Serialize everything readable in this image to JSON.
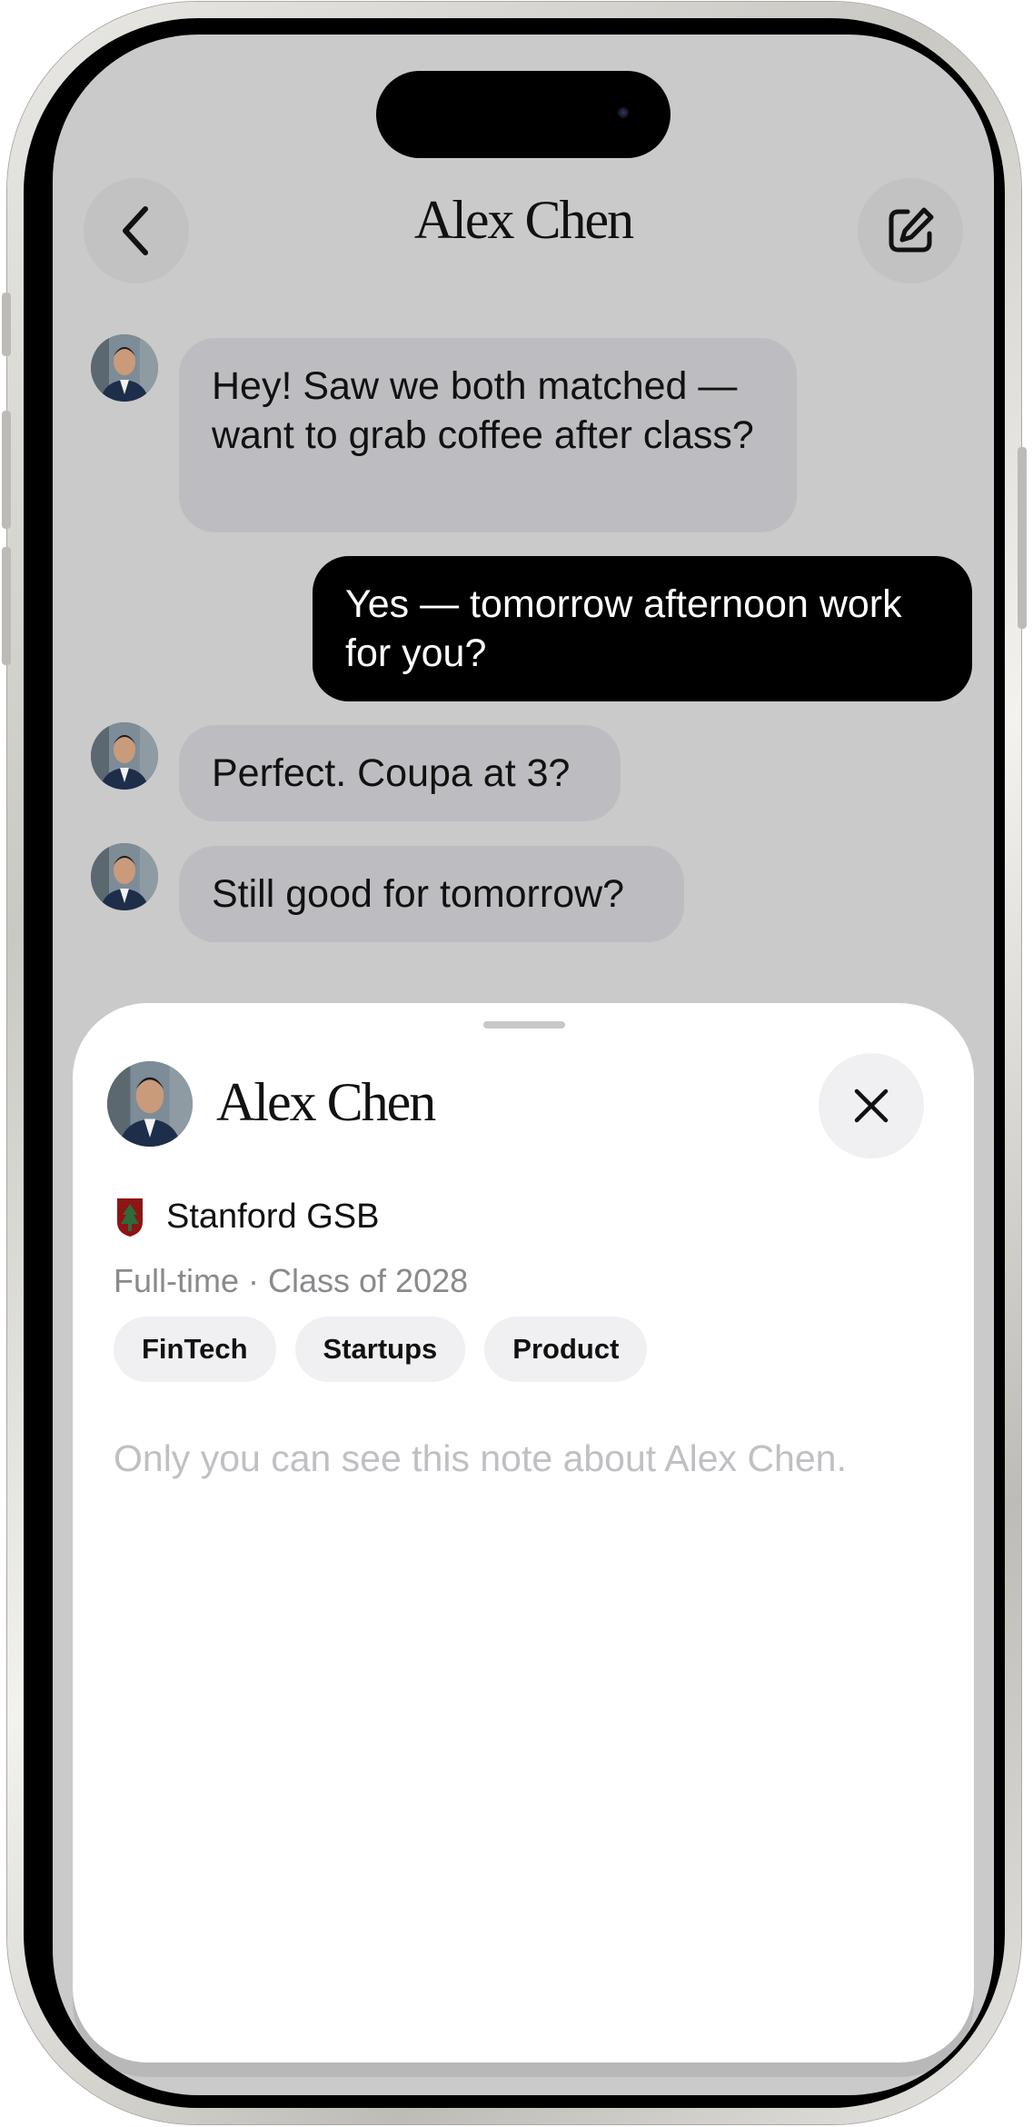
{
  "header": {
    "title": "Alex Chen",
    "back_icon": "chevron-left-icon",
    "compose_icon": "compose-icon"
  },
  "messages": [
    {
      "from": "them",
      "text": "Hey! Saw we both matched — want to grab coffee after class?"
    },
    {
      "from": "me",
      "text": "Yes — tomorrow afternoon work for you?"
    },
    {
      "from": "them",
      "text": "Perfect. Coupa at 3?"
    },
    {
      "from": "them",
      "text": "Still good for tomorrow?"
    }
  ],
  "profile_sheet": {
    "name": "Alex Chen",
    "school": "Stanford GSB",
    "program": "Full-time · Class of 2028",
    "tags": [
      "FinTech",
      "Startups",
      "Product"
    ],
    "note_placeholder": "Only you can see this note about Alex Chen.",
    "close_icon": "close-icon",
    "school_logo_icon": "stanford-logo-icon"
  },
  "colors": {
    "chat_background": "#cacaca",
    "incoming_bubble": "#bdbdc1",
    "outgoing_bubble": "#000000",
    "sheet_background": "#ffffff",
    "tag_background": "#f0f0f3"
  }
}
